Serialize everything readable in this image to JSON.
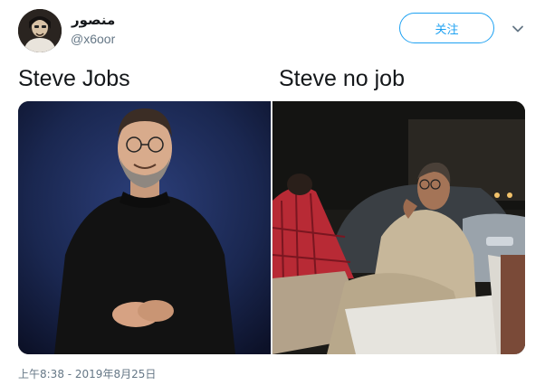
{
  "user": {
    "display_name": "منصور",
    "handle": "@x6oor"
  },
  "follow_button": {
    "label": "关注"
  },
  "captions": {
    "left": "Steve Jobs",
    "right": "Steve no job"
  },
  "timestamp": "上午8:38 - 2019年8月25日",
  "colors": {
    "accent": "#1da1f2",
    "secondary_text": "#657786",
    "primary_text": "#14171a"
  },
  "icons": {
    "menu": "chevron-down-icon"
  }
}
